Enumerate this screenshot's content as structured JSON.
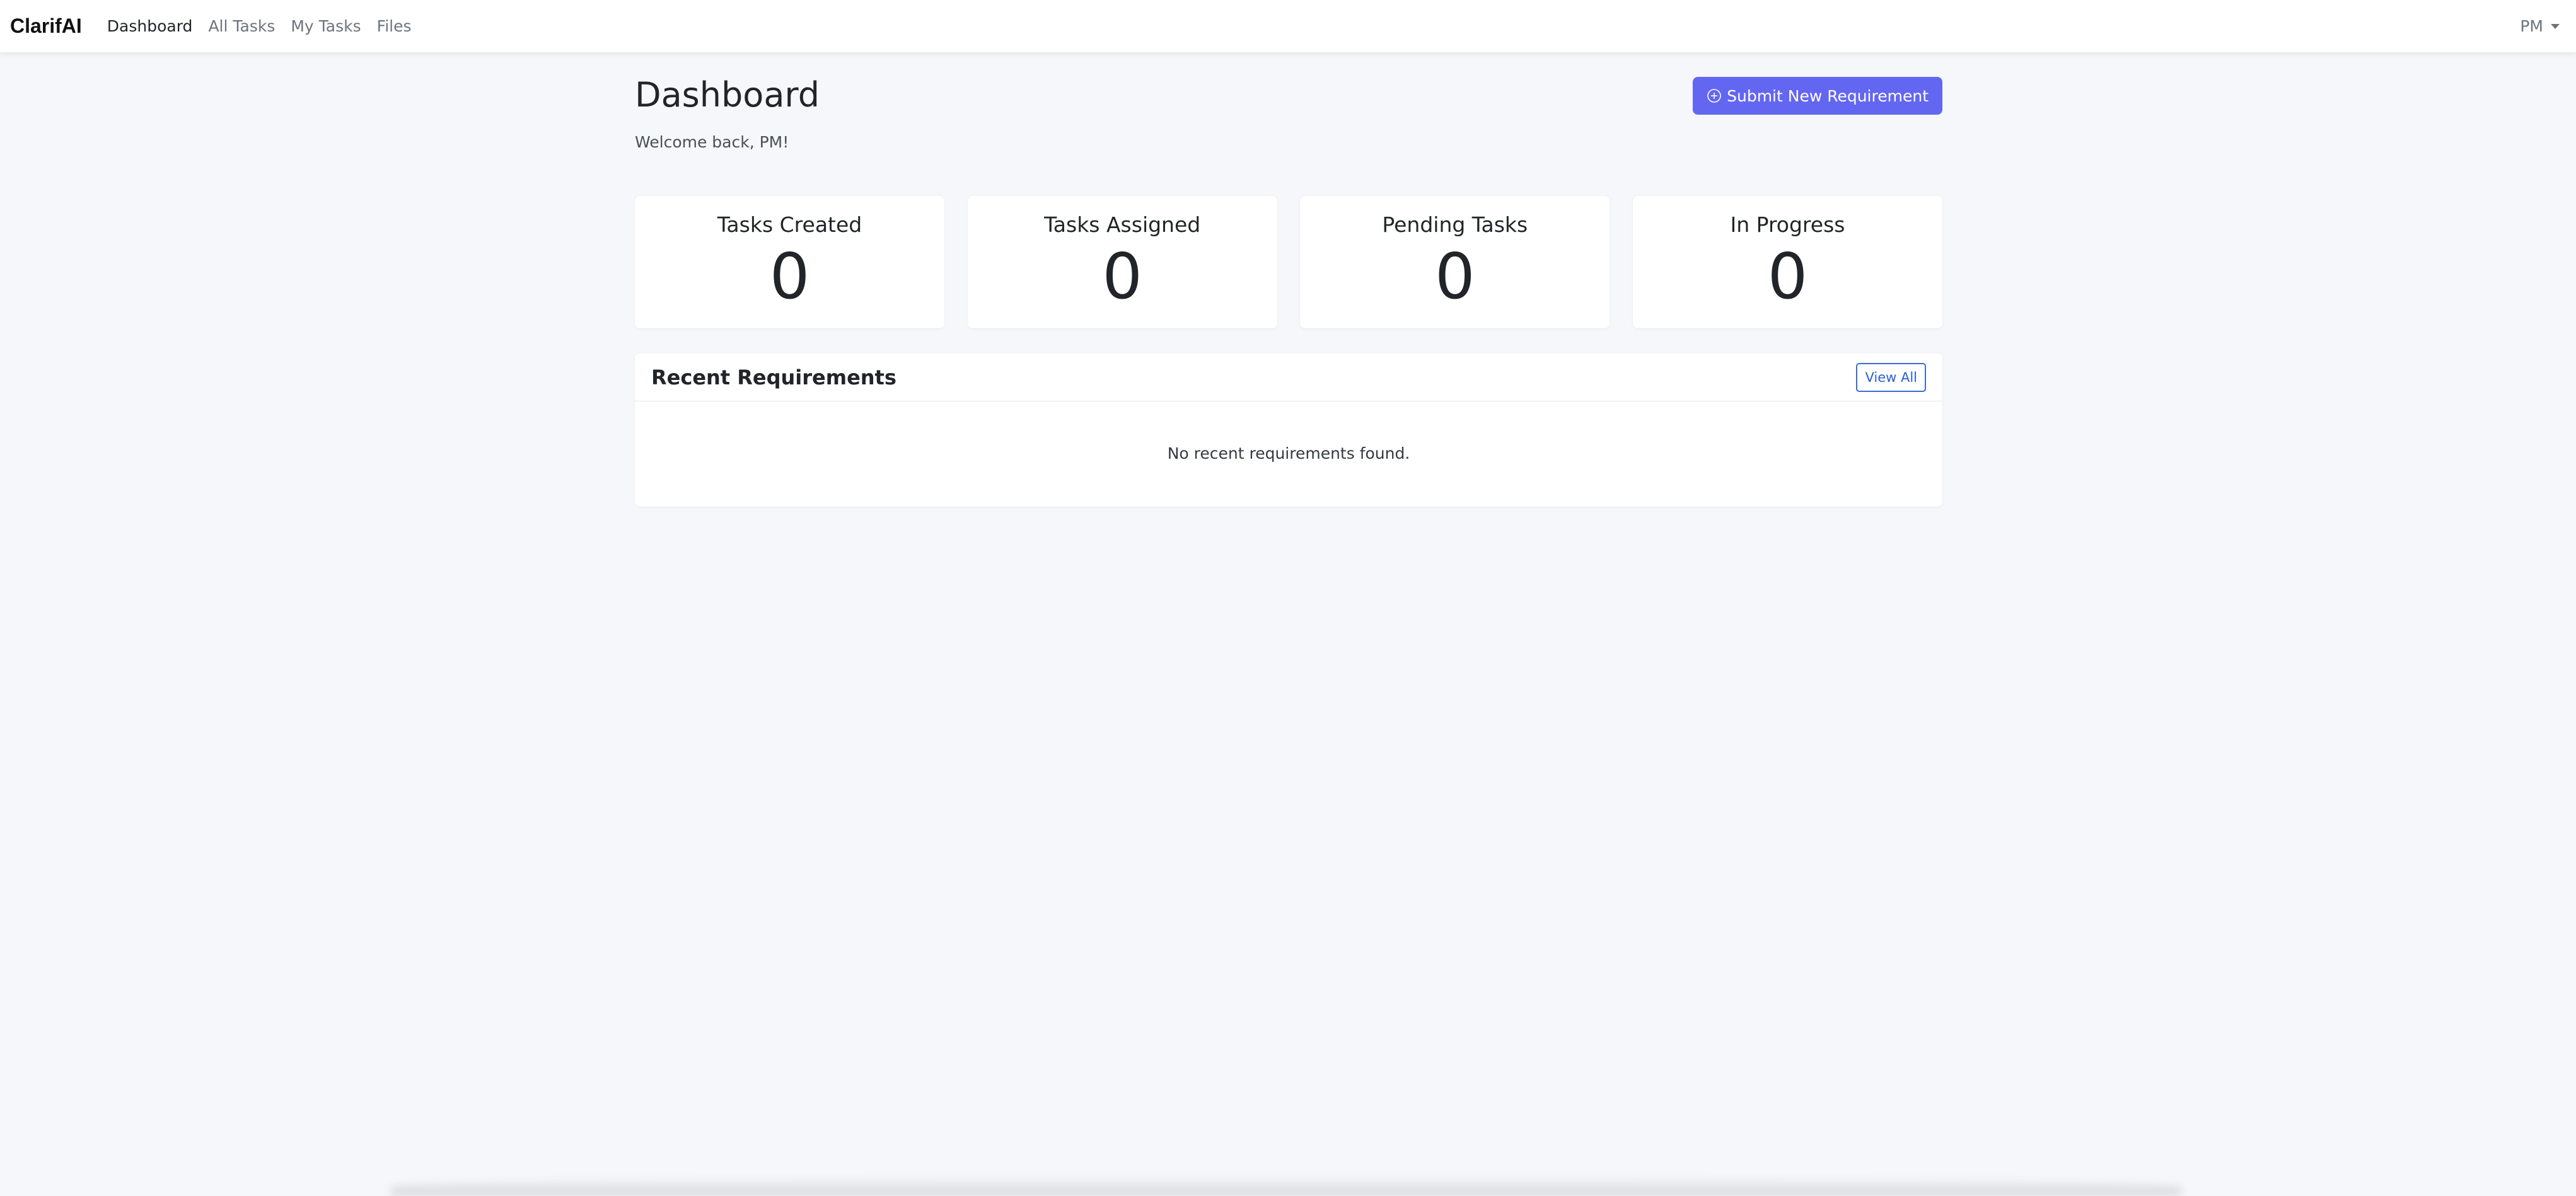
{
  "navbar": {
    "brand": "ClarifAI",
    "links": [
      {
        "label": "Dashboard",
        "active": true
      },
      {
        "label": "All Tasks",
        "active": false
      },
      {
        "label": "My Tasks",
        "active": false
      },
      {
        "label": "Files",
        "active": false
      }
    ],
    "user_label": "PM"
  },
  "header": {
    "title": "Dashboard",
    "welcome": "Welcome back, PM!",
    "submit_button": "Submit New Requirement"
  },
  "stats": [
    {
      "label": "Tasks Created",
      "value": "0"
    },
    {
      "label": "Tasks Assigned",
      "value": "0"
    },
    {
      "label": "Pending Tasks",
      "value": "0"
    },
    {
      "label": "In Progress",
      "value": "0"
    }
  ],
  "recent": {
    "title": "Recent Requirements",
    "view_all": "View All",
    "empty_message": "No recent requirements found."
  },
  "colors": {
    "primary": "#6366f1",
    "outline_blue": "#2b5fd9",
    "background": "#f5f7fa"
  },
  "icons": {
    "submit": "plus-circle-icon",
    "user_menu": "caret-down-icon"
  }
}
